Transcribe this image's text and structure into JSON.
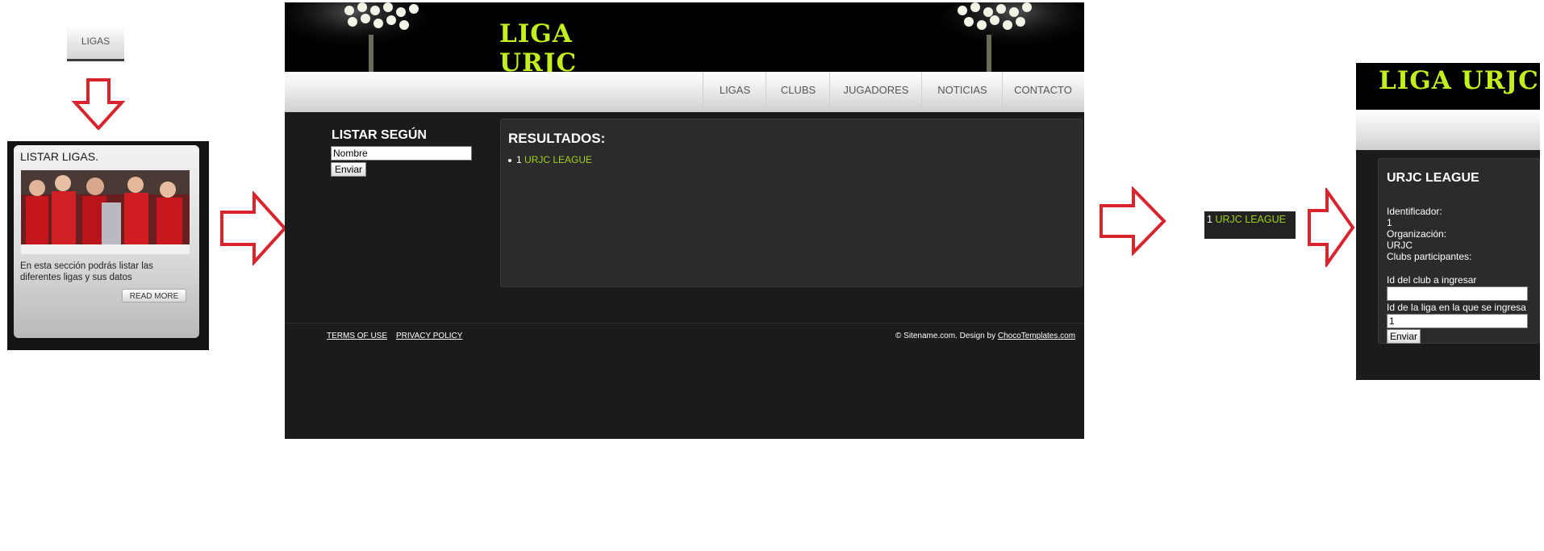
{
  "tab": {
    "label": "LIGAS"
  },
  "card": {
    "title": "LISTAR LIGAS.",
    "text": "En esta sección podrás listar las diferentes ligas y sus datos",
    "read_more": "READ MORE"
  },
  "site": {
    "logo": "LIGA URJC",
    "nav": [
      "LIGAS",
      "CLUBS",
      "JUGADORES",
      "NOTICIAS",
      "CONTACTO"
    ],
    "sidebar_title": "LISTAR SEGÚN",
    "input_value": "Nombre",
    "submit": "Enviar",
    "results_title": "RESULTADOS:",
    "result_index": "1",
    "result_name": "URJC LEAGUE",
    "footer_terms": "TERMS OF USE",
    "footer_privacy": "PRIVACY POLICY",
    "footer_copy": "© Sitename.com. Design by ",
    "footer_design": "ChocoTemplates.com"
  },
  "small_result": {
    "index": "1",
    "name": "URJC LEAGUE"
  },
  "detail": {
    "logo": "LIGA URJC",
    "title": "URJC LEAGUE",
    "id_label": "Identificador:",
    "id_value": "1",
    "org_label": "Organización:",
    "org_value": "URJC",
    "clubs_label": "Clubs participantes:",
    "club_id_label": "Id del club a ingresar",
    "club_id_value": "",
    "league_id_label": "Id de la liga en la que se ingresa",
    "league_id_value": "1",
    "submit": "Enviar"
  },
  "colors": {
    "accent": "#c3ef1c",
    "link": "#9fd21d",
    "arrow": "#d9232d"
  }
}
